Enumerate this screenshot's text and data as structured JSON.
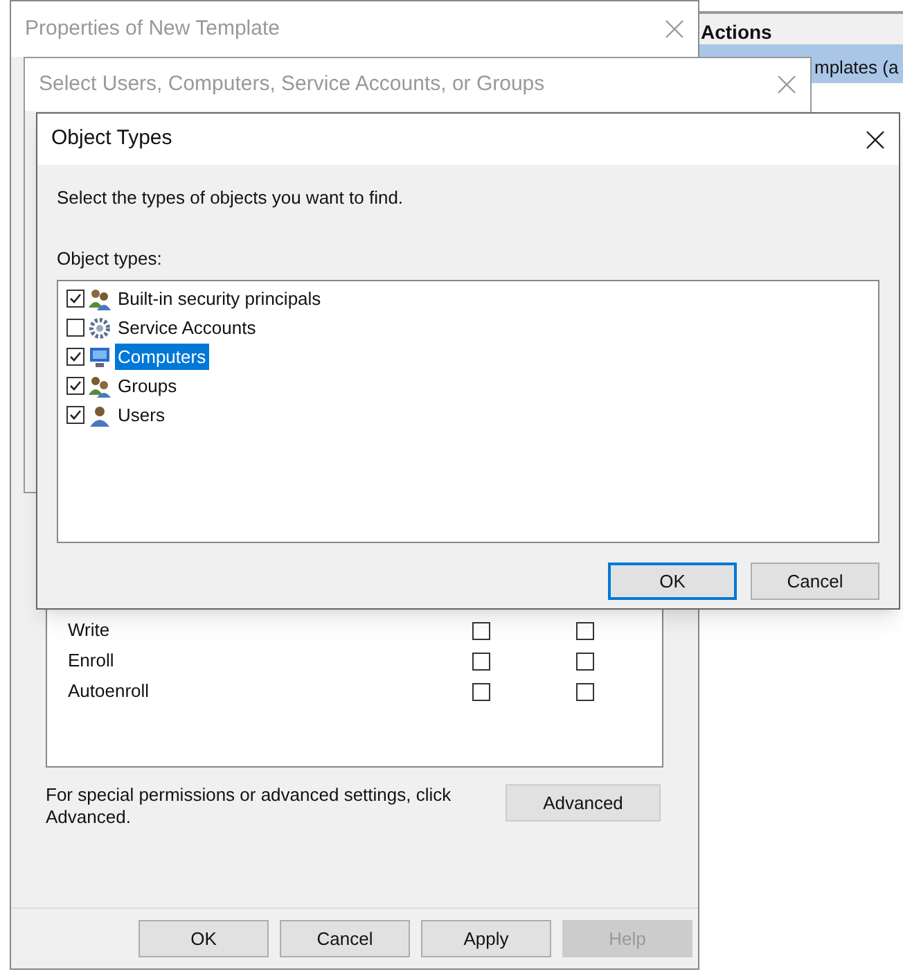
{
  "actions_panel": {
    "title": "Actions",
    "items": [
      {
        "label": "mplates (a",
        "selected": true
      }
    ]
  },
  "properties_window": {
    "title": "Properties of New Template",
    "permissions": [
      {
        "name": "Write",
        "allow": false,
        "deny": false
      },
      {
        "name": "Enroll",
        "allow": false,
        "deny": false
      },
      {
        "name": "Autoenroll",
        "allow": false,
        "deny": false
      }
    ],
    "advanced_note": "For special permissions or advanced settings, click Advanced.",
    "advanced_button": "Advanced",
    "buttons": [
      {
        "label": "OK",
        "disabled": false
      },
      {
        "label": "Cancel",
        "disabled": false
      },
      {
        "label": "Apply",
        "disabled": false
      },
      {
        "label": "Help",
        "disabled": true
      }
    ]
  },
  "select_window": {
    "title": "Select Users, Computers, Service Accounts, or Groups"
  },
  "object_types_dialog": {
    "title": "Object Types",
    "instruction": "Select the types of objects you want to find.",
    "list_label": "Object types:",
    "items": [
      {
        "label": "Built-in security principals",
        "kind": "principals",
        "checked": true,
        "selected": false
      },
      {
        "label": "Service Accounts",
        "kind": "service",
        "checked": false,
        "selected": false
      },
      {
        "label": "Computers",
        "kind": "computer",
        "checked": true,
        "selected": true
      },
      {
        "label": "Groups",
        "kind": "group",
        "checked": true,
        "selected": false
      },
      {
        "label": "Users",
        "kind": "user",
        "checked": true,
        "selected": false
      }
    ],
    "buttons": [
      {
        "label": "OK",
        "default": true
      },
      {
        "label": "Cancel",
        "default": false
      }
    ]
  }
}
